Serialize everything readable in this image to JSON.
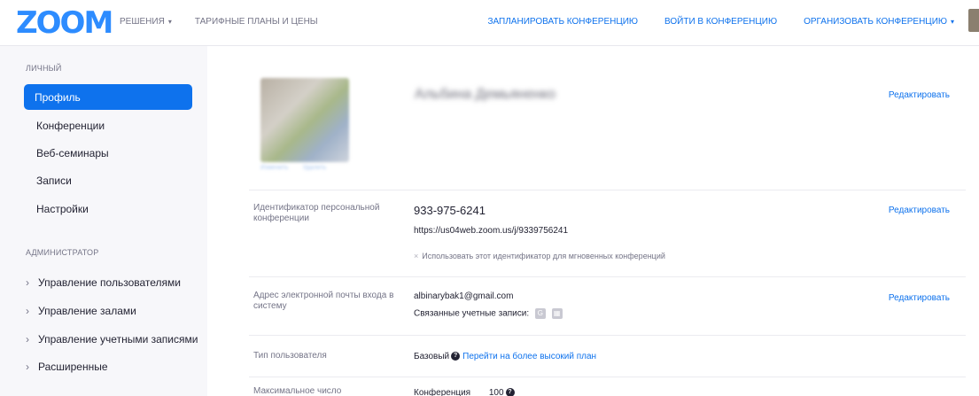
{
  "header": {
    "logo": "ZOOM",
    "nav_left": [
      {
        "label": "РЕШЕНИЯ",
        "has_caret": true
      },
      {
        "label": "ТАРИФНЫЕ ПЛАНЫ И ЦЕНЫ",
        "has_caret": false
      }
    ],
    "nav_right": [
      {
        "label": "ЗАПЛАНИРОВАТЬ КОНФЕРЕНЦИЮ"
      },
      {
        "label": "ВОЙТИ В КОНФЕРЕНЦИЮ"
      },
      {
        "label": "ОРГАНИЗОВАТЬ КОНФЕРЕНЦИЮ",
        "has_caret": true
      }
    ],
    "caret": "▾"
  },
  "sidebar": {
    "personal_title": "ЛИЧНЫЙ",
    "personal_items": [
      {
        "label": "Профиль",
        "active": true
      },
      {
        "label": "Конференции"
      },
      {
        "label": "Веб-семинары"
      },
      {
        "label": "Записи"
      },
      {
        "label": "Настройки"
      }
    ],
    "admin_title": "АДМИНИСТРАТОР",
    "admin_items": [
      {
        "label": "Управление пользователями"
      },
      {
        "label": "Управление залами"
      },
      {
        "label": "Управление учетными записями"
      },
      {
        "label": "Расширенные"
      }
    ],
    "chevron": "›"
  },
  "profile": {
    "name": "Альбина Демьяненко",
    "photo_links": [
      "Изменить",
      "Удалить"
    ],
    "edit_label": "Редактировать"
  },
  "rows": {
    "pmi": {
      "label": "Идентификатор персональной конференции",
      "value": "933-975-6241",
      "url": "https://us04web.zoom.us/j/9339756241",
      "option": "Использовать этот идентификатор для мгновенных конференций",
      "edit_label": "Редактировать"
    },
    "email": {
      "label": "Адрес электронной почты входа в систему",
      "value": "albinarybak1@gmail.com",
      "linked_label": "Связанные учетные записи:",
      "linked_icons": [
        "G",
        "▦"
      ],
      "edit_label": "Редактировать"
    },
    "user_type": {
      "label": "Тип пользователя",
      "value": "Базовый",
      "upgrade_link": "Перейти на более высокий план"
    },
    "capacity": {
      "label": "Максимальное число",
      "value_label": "Конференция",
      "value": "100"
    }
  },
  "colors": {
    "brand": "#2d8cff",
    "accent": "#0e72ed",
    "sidebar_bg": "#f7f7fa",
    "text": "#232333",
    "muted": "#747487"
  }
}
